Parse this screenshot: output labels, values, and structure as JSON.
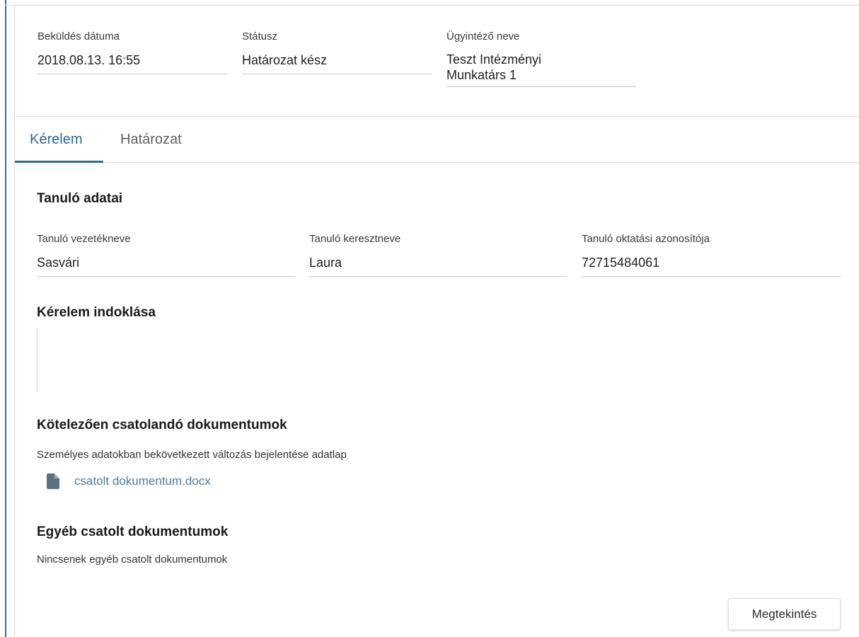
{
  "header": {
    "submitted": {
      "label": "Beküldés dátuma",
      "value": "2018.08.13. 16:55"
    },
    "status": {
      "label": "Státusz",
      "value": "Határozat kész"
    },
    "handler": {
      "label": "Ügyintéző neve",
      "value": "Teszt Intézményi Munkatárs 1"
    }
  },
  "tabs": [
    {
      "label": "Kérelem",
      "active": true
    },
    {
      "label": "Határozat",
      "active": false
    }
  ],
  "student": {
    "title": "Tanuló adatai",
    "last_name": {
      "label": "Tanuló vezetékneve",
      "value": "Sasvári"
    },
    "first_name": {
      "label": "Tanuló keresztneve",
      "value": "Laura"
    },
    "edu_id": {
      "label": "Tanuló oktatási azonosítója",
      "value": "72715484061"
    }
  },
  "justification": {
    "title": "Kérelem indoklása",
    "value": ""
  },
  "mandatory_docs": {
    "title": "Kötelezően csatolandó dokumentumok",
    "doc_type": "Személyes adatokban bekövetkezett változás bejelentése adatlap",
    "file_name": "csatolt dokumentum.docx",
    "file_icon": "file-icon"
  },
  "other_docs": {
    "title": "Egyéb csatolt dokumentumok",
    "empty_text": "Nincsenek egyéb csatolt dokumentumok"
  },
  "actions": {
    "view_label": "Megtekintés"
  },
  "colors": {
    "accent": "#2f6a90",
    "frame": "#2e6cb3",
    "link": "#557a94"
  }
}
